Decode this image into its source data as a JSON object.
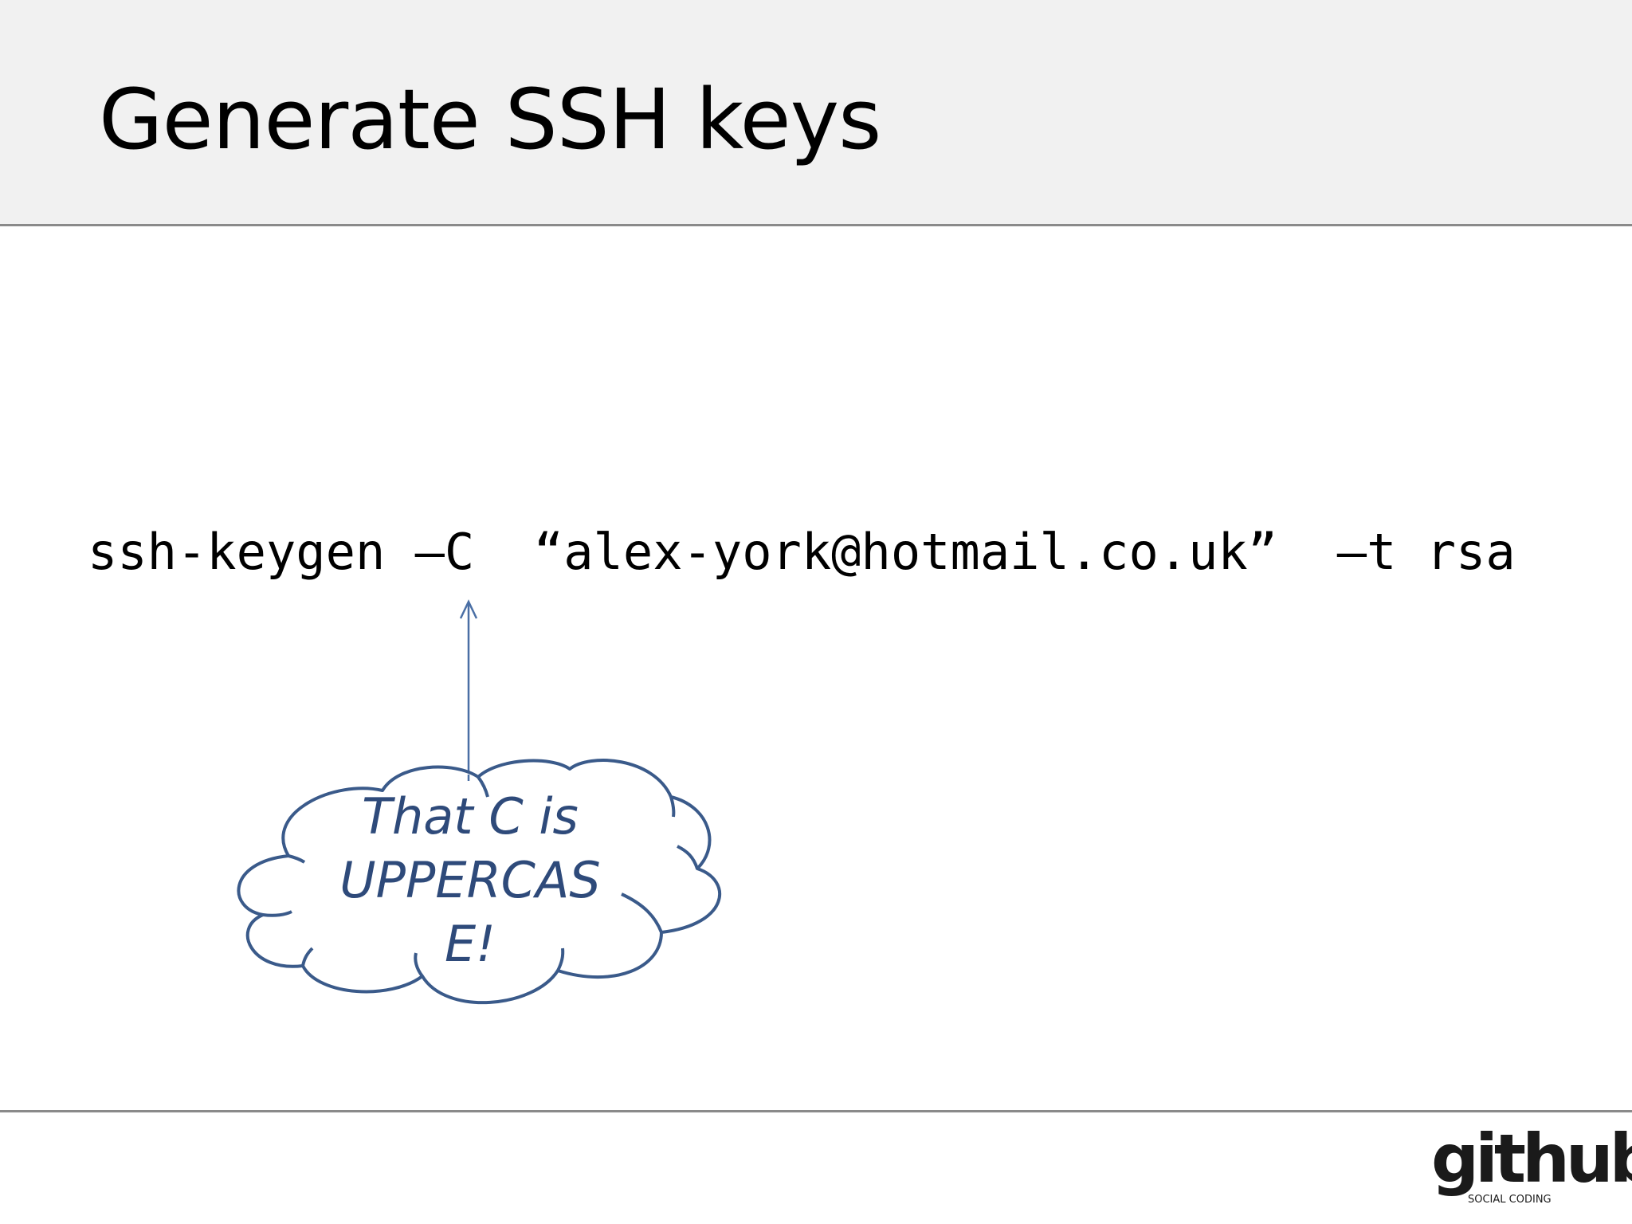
{
  "slide": {
    "title": "Generate SSH keys",
    "command": "ssh-keygen –C  “alex-york@hotmail.co.uk”  –t rsa",
    "callout": {
      "lines": [
        "That C is",
        "UPPERCAS",
        "E!"
      ]
    },
    "logo": {
      "word": "github",
      "tagline": "SOCIAL CODING"
    }
  },
  "colors": {
    "title_band": "#f1f1f1",
    "rule": "#8a8a8a",
    "annotation": "#2e4a7a",
    "arrow": "#4a6fa5",
    "text": "#000000"
  },
  "icons": {
    "callout_shape": "thought-cloud",
    "arrow": "arrow-up-icon"
  }
}
